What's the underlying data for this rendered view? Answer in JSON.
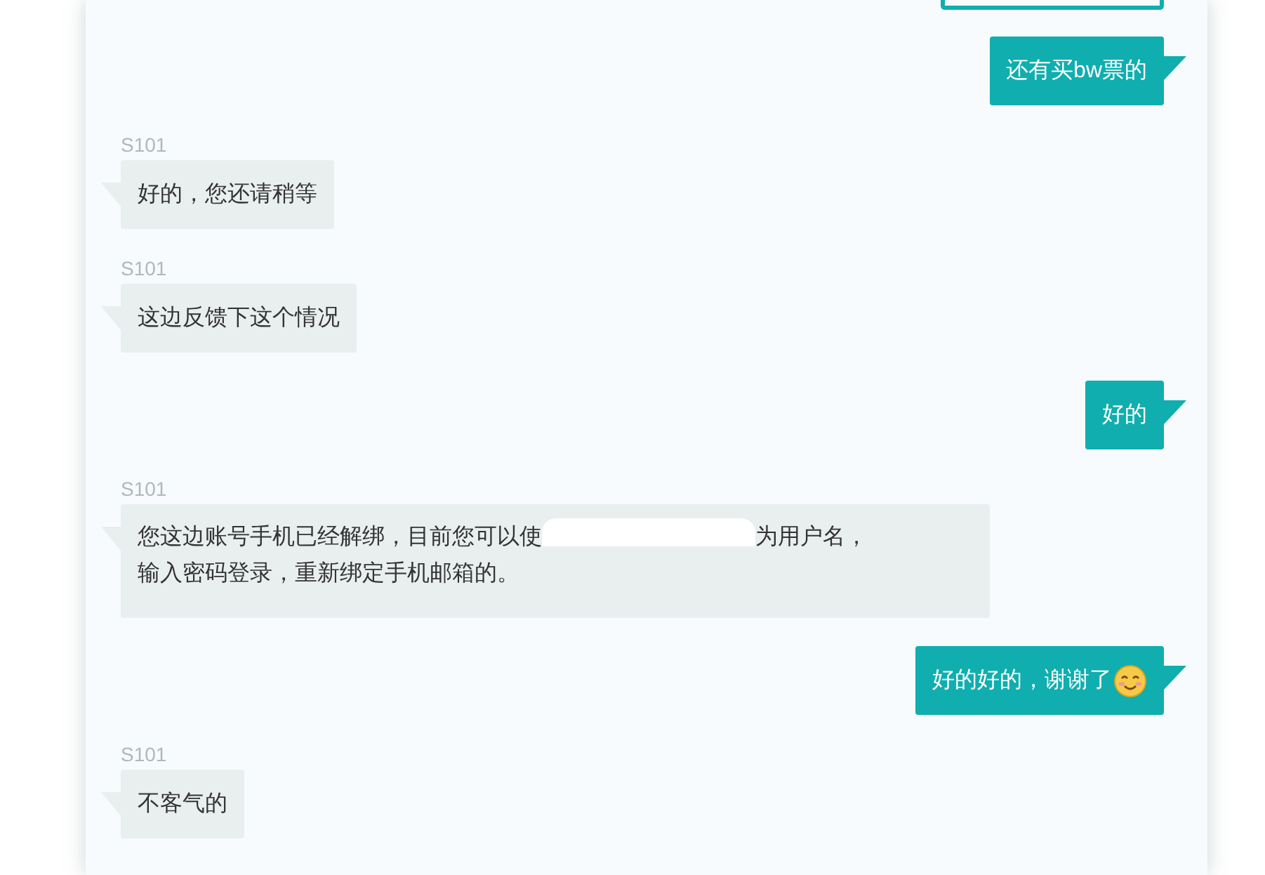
{
  "messages": [
    {
      "kind": "card"
    },
    {
      "kind": "sent",
      "text": "还有买bw票的"
    },
    {
      "kind": "received",
      "sender": "S101",
      "lines": [
        [
          "好的，您还请稍等"
        ]
      ]
    },
    {
      "kind": "received",
      "sender": "S101",
      "lines": [
        [
          "这边反馈下这个情况"
        ]
      ]
    },
    {
      "kind": "sent",
      "text": "好的"
    },
    {
      "kind": "received",
      "sender": "S101",
      "lines": [
        [
          "您这边账号手机已经解绑，目前您可以使",
          "为用户名，"
        ],
        [
          "输入密码登录，重新绑定手机邮箱的。"
        ]
      ]
    },
    {
      "kind": "sent",
      "text": "好的好的，谢谢了",
      "emoji": true
    },
    {
      "kind": "received",
      "sender": "S101",
      "lines": [
        [
          "不客气的"
        ]
      ]
    }
  ]
}
